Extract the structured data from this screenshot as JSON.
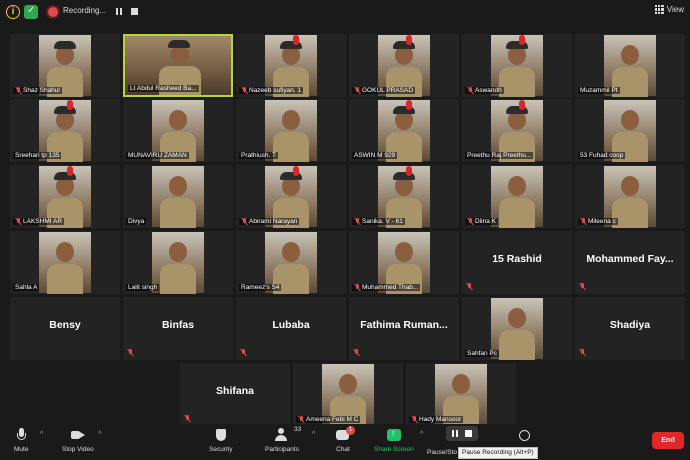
{
  "topbar": {
    "recording_label": "Recording...",
    "view_label": "View"
  },
  "participants": [
    {
      "name": "Shaz Shahul",
      "muted": true,
      "video": true
    },
    {
      "name": "Lt Abdul Rasheed Ba...",
      "muted": false,
      "video": true,
      "active_speaker": true
    },
    {
      "name": "Nazeeb sufiyan. 1",
      "muted": true,
      "video": true
    },
    {
      "name": "GOKUL PRASAD",
      "muted": true,
      "video": true
    },
    {
      "name": "Aswandh",
      "muted": true,
      "video": true
    },
    {
      "name": "Muzammil Pt",
      "muted": false,
      "video": true
    },
    {
      "name": "Sreehari tp 135",
      "muted": false,
      "video": true
    },
    {
      "name": "MUNAVIRU ZAMAN",
      "muted": false,
      "video": true
    },
    {
      "name": "Prathiush. T",
      "muted": false,
      "video": true
    },
    {
      "name": "ASWIN M 929",
      "muted": false,
      "video": true
    },
    {
      "name": "Preethu Raj Preethu...",
      "muted": false,
      "video": true
    },
    {
      "name": "53 Fuhad coop",
      "muted": false,
      "video": true
    },
    {
      "name": "LAKSHMI AR",
      "muted": true,
      "video": true
    },
    {
      "name": "Divya",
      "muted": false,
      "video": true
    },
    {
      "name": "Abirami Narayan",
      "muted": true,
      "video": true
    },
    {
      "name": "Sanika. V - 61",
      "muted": true,
      "video": true
    },
    {
      "name": "Dilna K",
      "muted": true,
      "video": true
    },
    {
      "name": "Mileena c",
      "muted": true,
      "video": true
    },
    {
      "name": "Sahla A",
      "muted": false,
      "video": true
    },
    {
      "name": "Lalit singh",
      "muted": false,
      "video": true
    },
    {
      "name": "Rameez's S4",
      "muted": false,
      "video": true
    },
    {
      "name": "Muhammed Thab...",
      "muted": true,
      "video": true
    },
    {
      "name": "15 Rashid",
      "muted": true,
      "video": false
    },
    {
      "name": "Mohammed Fay...",
      "muted": true,
      "video": false
    },
    {
      "name": "Bensy",
      "muted": false,
      "video": false
    },
    {
      "name": "Binfas",
      "muted": true,
      "video": false
    },
    {
      "name": "Lubaba",
      "muted": true,
      "video": false
    },
    {
      "name": "Fathima Ruman...",
      "muted": true,
      "video": false
    },
    {
      "name": "Sahfan Pc",
      "muted": false,
      "video": true
    },
    {
      "name": "Shadiya",
      "muted": true,
      "video": false
    },
    {
      "name": "Shifana",
      "muted": true,
      "video": false
    },
    {
      "name": "Ameena Febi M C",
      "muted": true,
      "video": true
    },
    {
      "name": "Hady Mansoor",
      "muted": true,
      "video": true
    }
  ],
  "toolbar": {
    "mute_label": "Mute",
    "stop_video_label": "Stop Video",
    "security_label": "Security",
    "participants_label": "Participants",
    "participants_count": "33",
    "chat_label": "Chat",
    "chat_badge": "1",
    "share_screen_label": "Share Screen",
    "pause_stop_label": "Pause/Sto",
    "pause_tooltip": "Pause Recording (Alt+P)",
    "end_label": "End"
  },
  "colors": {
    "background": "#1a1a1a",
    "tile_background": "#232323",
    "active_speaker_border": "#b7d33b",
    "share_green": "#23c16b",
    "end_red": "#e02828",
    "muted_red": "#e5484d"
  }
}
